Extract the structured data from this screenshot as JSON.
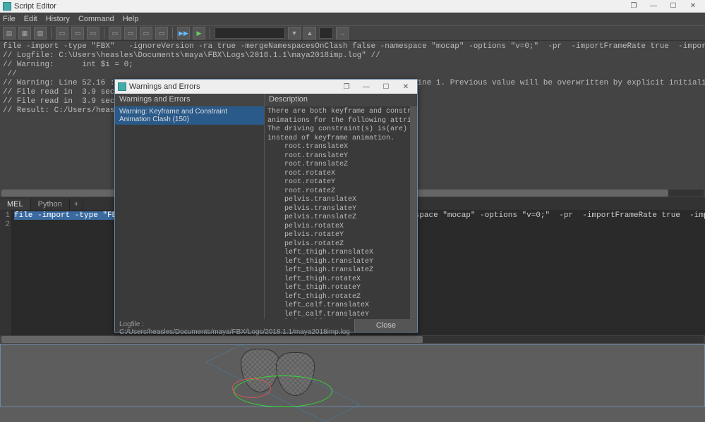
{
  "window": {
    "title": "Script Editor",
    "menu": [
      "File",
      "Edit",
      "History",
      "Command",
      "Help"
    ]
  },
  "output": "file -import -type \"FBX\"   -ignoreVersion -ra true -mergeNamespacesOnClash false -namespace \"mocap\" -options \"v=0;\"  -pr  -importFrameRate true  -importTimeRange \"combine\" \"C:/Users/heasles/Downloads/maya_char_test_mo\n// Logfile: C:\\Users\\heasles\\Documents\\maya\\FBX\\Logs\\2018.1.1\\maya2018imp.log\" //\n// Warning:      int $i = 0;\n //\n// Warning: Line 52.16 : Redeclaration of variable \"$i\" shadows previous declaration at line 1. Previous value will be overwritten by explicit initializer. //\n// File read in  3.9 seconds. //\n// File read in  3.9 seconds. //\n// Result: C:/Users/heasles/Downloads/maya_char_test_mocap_source.fbx //",
  "tabs": {
    "items": [
      "MEL",
      "Python",
      "+"
    ],
    "active": 0
  },
  "code": {
    "line1_sel": "file -import -type \"FBX\"   -ign",
    "line1_rest": "oreVersion -ra true -mergeNamespacesOnClash false -namespace \"mocap\" -options \"v=0;\"  -pr  -importFrameRate true  -importTimeRange \"combine\" \"C:/Users/heasles/Downloads/maya_char_te",
    "row2": "2"
  },
  "modal": {
    "title": "Warnings and Errors",
    "col1": "Warnings and Errors",
    "col2": "Description",
    "warning_row": "Warning: Keyframe and Constraint Animation Clash (150)",
    "description": "There are both keyframe and constraint\nanimations for the following attribute(s).\nThe driving constraint(s) is(are) used\ninstead of keyframe animation.\n    root.translateX\n    root.translateY\n    root.translateZ\n    root.rotateX\n    root.rotateY\n    root.rotateZ\n    pelvis.translateX\n    pelvis.translateY\n    pelvis.translateZ\n    pelvis.rotateX\n    pelvis.rotateY\n    pelvis.rotateZ\n    left_thigh.translateX\n    left_thigh.translateY\n    left_thigh.translateZ\n    left_thigh.rotateX\n    left_thigh.rotateY\n    left_thigh.rotateZ\n    left_calf.translateX\n    left_calf.translateY\n    left_calf.translateZ\n    left_calf.rotateX\n    left_calf.rotateY\n    left_calf.rotateZ\n    left_foot.translateX\n    left_foot.translateY\n    left_foot.translateZ\n    left_foot.rotateX\n    left_foot.rotateY\n    left_foot.rotateZ\n    left_ball.translateX\n    left_ball.translateY",
    "logfile": "Logfile : C:/Users/heasles/Documents/maya/FBX/Logs/2018.1.1/maya2018imp.log",
    "close": "Close"
  }
}
